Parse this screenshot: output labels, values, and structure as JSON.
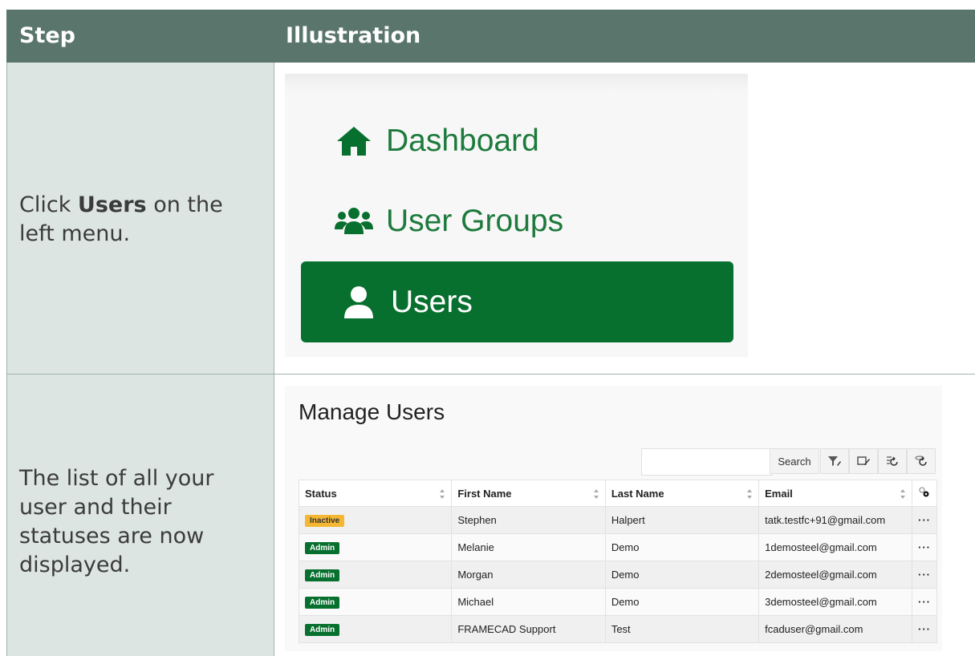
{
  "header": {
    "step": "Step",
    "illustration": "Illustration"
  },
  "rows": [
    {
      "prefix": "Click ",
      "bold": "Users",
      "suffix": " on the left menu."
    },
    {
      "text": "The list of all your user and their statuses are now displayed."
    }
  ],
  "menu": {
    "items": [
      {
        "label": "Dashboard",
        "icon": "home-icon"
      },
      {
        "label": "User Groups",
        "icon": "user-groups-icon"
      },
      {
        "label": "Users",
        "icon": "user-icon",
        "active": true
      }
    ],
    "accent": "#08702f"
  },
  "manage_users": {
    "title": "Manage Users",
    "search_button": "Search",
    "search_placeholder": "",
    "tools": [
      "filter-icon",
      "edit-filter-icon",
      "reset-sort-icon",
      "refresh-icon"
    ],
    "columns": [
      "Status",
      "First Name",
      "Last Name",
      "Email"
    ],
    "rows": [
      {
        "status": "Inactive",
        "first": "Stephen",
        "last": "Halpert",
        "email": "tatk.testfc+91@gmail.com"
      },
      {
        "status": "Admin",
        "first": "Melanie",
        "last": "Demo",
        "email": "1demosteel@gmail.com"
      },
      {
        "status": "Admin",
        "first": "Morgan",
        "last": "Demo",
        "email": "2demosteel@gmail.com"
      },
      {
        "status": "Admin",
        "first": "Michael",
        "last": "Demo",
        "email": "3demosteel@gmail.com"
      },
      {
        "status": "Admin",
        "first": "FRAMECAD Support",
        "last": "Test",
        "email": "fcaduser@gmail.com"
      }
    ],
    "row_action": "···"
  },
  "colors": {
    "header_bg": "#5a756c",
    "step_col_bg": "#dce5e2",
    "inactive": "#f5b731",
    "admin": "#08702f"
  }
}
